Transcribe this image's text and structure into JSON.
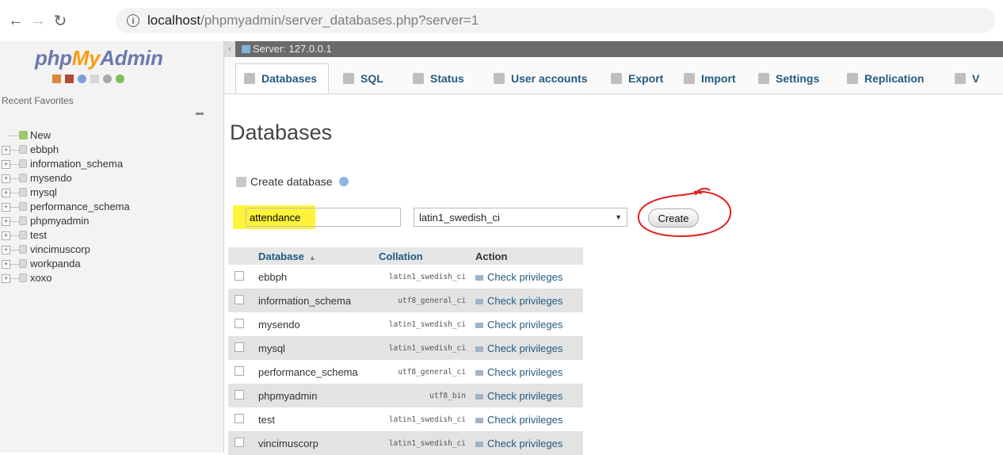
{
  "browser": {
    "url_host": "localhost",
    "url_path": "/phpmyadmin/server_databases.php?server=1"
  },
  "nav": {
    "logo_php": "php",
    "logo_my": "My",
    "logo_admin": "Admin",
    "recent_favorites": "Recent  Favorites",
    "new_label": "New",
    "databases": [
      "ebbph",
      "information_schema",
      "mysendo",
      "mysql",
      "performance_schema",
      "phpmyadmin",
      "test",
      "vincimuscorp",
      "workpanda",
      "xoxo"
    ]
  },
  "serverbar": {
    "label": "Server: 127.0.0.1"
  },
  "tabs": [
    "Databases",
    "SQL",
    "Status",
    "User accounts",
    "Export",
    "Import",
    "Settings",
    "Replication",
    "V"
  ],
  "main": {
    "title": "Databases",
    "create_db_label": "Create database",
    "db_name_value": "attendance",
    "collation_value": "latin1_swedish_ci",
    "create_button": "Create"
  },
  "table": {
    "headers": {
      "database": "Database",
      "collation": "Collation",
      "action": "Action"
    },
    "rows": [
      {
        "name": "ebbph",
        "collation": "latin1_swedish_ci",
        "action": "Check privileges"
      },
      {
        "name": "information_schema",
        "collation": "utf8_general_ci",
        "action": "Check privileges"
      },
      {
        "name": "mysendo",
        "collation": "latin1_swedish_ci",
        "action": "Check privileges"
      },
      {
        "name": "mysql",
        "collation": "latin1_swedish_ci",
        "action": "Check privileges"
      },
      {
        "name": "performance_schema",
        "collation": "utf8_general_ci",
        "action": "Check privileges"
      },
      {
        "name": "phpmyadmin",
        "collation": "utf8_bin",
        "action": "Check privileges"
      },
      {
        "name": "test",
        "collation": "latin1_swedish_ci",
        "action": "Check privileges"
      },
      {
        "name": "vincimuscorp",
        "collation": "latin1_swedish_ci",
        "action": "Check privileges"
      }
    ]
  },
  "colors": {
    "highlight": "#fff43a",
    "annotation": "#e02020",
    "link": "#235a81"
  }
}
